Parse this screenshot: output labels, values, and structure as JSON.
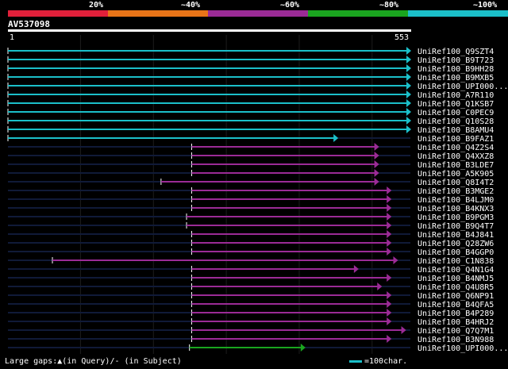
{
  "scale": {
    "labels": [
      "20%",
      "~40%",
      "~60%",
      "~80%",
      "~100%"
    ],
    "colors": [
      "#e0203a",
      "#e87418",
      "#9b2b96",
      "#1aa51f",
      "#1bbfc9"
    ]
  },
  "query": {
    "id": "AV537098",
    "start": "1",
    "end": "553"
  },
  "legend": {
    "gaps": "Large gaps:▲(in Query)/- (in Subject)",
    "scale_unit": "=100char."
  },
  "chart_data": {
    "type": "alignment",
    "query_length": 553,
    "hits": [
      {
        "name": "UniRef100_Q9SZT4",
        "start": 1,
        "end": 553,
        "color": "#1bbfc9"
      },
      {
        "name": "UniRef100_B9T723",
        "start": 1,
        "end": 553,
        "color": "#1bbfc9"
      },
      {
        "name": "UniRef100_B9HH28",
        "start": 1,
        "end": 553,
        "color": "#1bbfc9"
      },
      {
        "name": "UniRef100_B9MXB5",
        "start": 1,
        "end": 553,
        "color": "#1bbfc9"
      },
      {
        "name": "UniRef100_UPI000...",
        "start": 1,
        "end": 553,
        "color": "#1bbfc9"
      },
      {
        "name": "UniRef100_A7R110",
        "start": 1,
        "end": 553,
        "color": "#1bbfc9"
      },
      {
        "name": "UniRef100_Q1KSB7",
        "start": 1,
        "end": 553,
        "color": "#1bbfc9"
      },
      {
        "name": "UniRef100_C0PEC9",
        "start": 1,
        "end": 553,
        "color": "#1bbfc9"
      },
      {
        "name": "UniRef100_Q10S28",
        "start": 1,
        "end": 553,
        "color": "#1bbfc9"
      },
      {
        "name": "UniRef100_B8AMU4",
        "start": 1,
        "end": 553,
        "color": "#1bbfc9"
      },
      {
        "name": "UniRef100_B9FAZ1",
        "start": 1,
        "end": 453,
        "color": "#1bbfc9"
      },
      {
        "name": "UniRef100_Q4Z2S4",
        "start": 253,
        "end": 509,
        "color": "#9b2b96"
      },
      {
        "name": "UniRef100_Q4XXZ8",
        "start": 253,
        "end": 509,
        "color": "#9b2b96"
      },
      {
        "name": "UniRef100_B3LDE7",
        "start": 253,
        "end": 509,
        "color": "#9b2b96"
      },
      {
        "name": "UniRef100_A5K905",
        "start": 253,
        "end": 509,
        "color": "#9b2b96"
      },
      {
        "name": "UniRef100_Q8I4T2",
        "start": 211,
        "end": 509,
        "color": "#9b2b96"
      },
      {
        "name": "UniRef100_B3MGE2",
        "start": 253,
        "end": 526,
        "color": "#9b2b96"
      },
      {
        "name": "UniRef100_B4LJM0",
        "start": 253,
        "end": 526,
        "color": "#9b2b96"
      },
      {
        "name": "UniRef100_B4KNX3",
        "start": 253,
        "end": 526,
        "color": "#9b2b96"
      },
      {
        "name": "UniRef100_B9PGM3",
        "start": 246,
        "end": 526,
        "color": "#9b2b96"
      },
      {
        "name": "UniRef100_B9Q4T7",
        "start": 246,
        "end": 526,
        "color": "#9b2b96"
      },
      {
        "name": "UniRef100_B4J841",
        "start": 253,
        "end": 526,
        "color": "#9b2b96"
      },
      {
        "name": "UniRef100_Q28ZW6",
        "start": 253,
        "end": 526,
        "color": "#9b2b96"
      },
      {
        "name": "UniRef100_B4GGP0",
        "start": 253,
        "end": 526,
        "color": "#9b2b96"
      },
      {
        "name": "UniRef100_C1N838",
        "start": 62,
        "end": 535,
        "color": "#9b2b96"
      },
      {
        "name": "UniRef100_Q4N1G4",
        "start": 253,
        "end": 481,
        "color": "#9b2b96"
      },
      {
        "name": "UniRef100_B4NMJ5",
        "start": 253,
        "end": 526,
        "color": "#9b2b96"
      },
      {
        "name": "UniRef100_Q4U8R5",
        "start": 253,
        "end": 513,
        "color": "#9b2b96"
      },
      {
        "name": "UniRef100_Q6NP91",
        "start": 253,
        "end": 526,
        "color": "#9b2b96"
      },
      {
        "name": "UniRef100_B4QFA5",
        "start": 253,
        "end": 526,
        "color": "#9b2b96"
      },
      {
        "name": "UniRef100_B4P289",
        "start": 253,
        "end": 526,
        "color": "#9b2b96"
      },
      {
        "name": "UniRef100_B4HRJ2",
        "start": 253,
        "end": 526,
        "color": "#9b2b96"
      },
      {
        "name": "UniRef100_Q7Q7M1",
        "start": 253,
        "end": 546,
        "color": "#9b2b96"
      },
      {
        "name": "UniRef100_B3N988",
        "start": 253,
        "end": 526,
        "color": "#9b2b96"
      },
      {
        "name": "UniRef100_UPI000...",
        "start": 250,
        "end": 408,
        "color": "#1aa51f"
      }
    ]
  }
}
